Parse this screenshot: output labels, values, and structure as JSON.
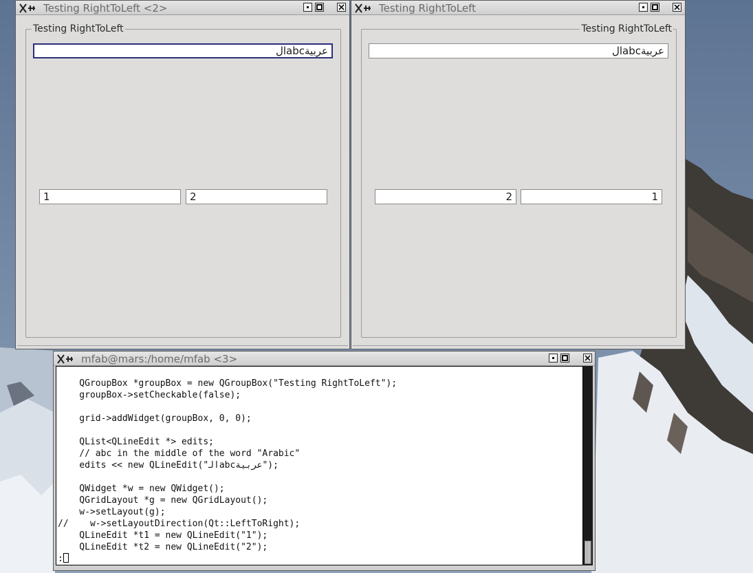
{
  "windows": {
    "left": {
      "title": "Testing RightToLeft <2>",
      "groupbox_title": "Testing RightToLeft",
      "top_field": "عربيةabcال",
      "field1": "1",
      "field2": "2"
    },
    "right": {
      "title": "Testing RightToLeft",
      "groupbox_title": "Testing RightToLeft",
      "top_field": "عربيةabcال",
      "field_left": "2",
      "field_right": "1"
    },
    "terminal": {
      "title": "mfab@mars:/home/mfab <3>",
      "prompt": ":",
      "lines": [
        "    QGroupBox *groupBox = new QGroupBox(\"Testing RightToLeft\");",
        "    groupBox->setCheckable(false);",
        "",
        "    grid->addWidget(groupBox, 0, 0);",
        "",
        "    QList<QLineEdit *> edits;",
        "    // abc in the middle of the word \"Arabic\"",
        "    edits << new QLineEdit(\"ﺍﻟabcﻋﺮﺑﻴﺔ\");",
        "",
        "    QWidget *w = new QWidget();",
        "    QGridLayout *g = new QGridLayout();",
        "    w->setLayout(g);",
        "//    w->setLayoutDirection(Qt::LeftToRight);",
        "    QLineEdit *t1 = new QLineEdit(\"1\");",
        "    QLineEdit *t2 = new QLineEdit(\"2\");"
      ]
    }
  },
  "icons": {
    "window_menu": "x-pin-icon",
    "minimize": "minimize-icon",
    "maximize": "maximize-icon",
    "close": "close-icon"
  },
  "colors": {
    "window_bg": "#dedddc",
    "focus_border": "#2b2f7a",
    "terminal_bg": "#ffffff"
  }
}
